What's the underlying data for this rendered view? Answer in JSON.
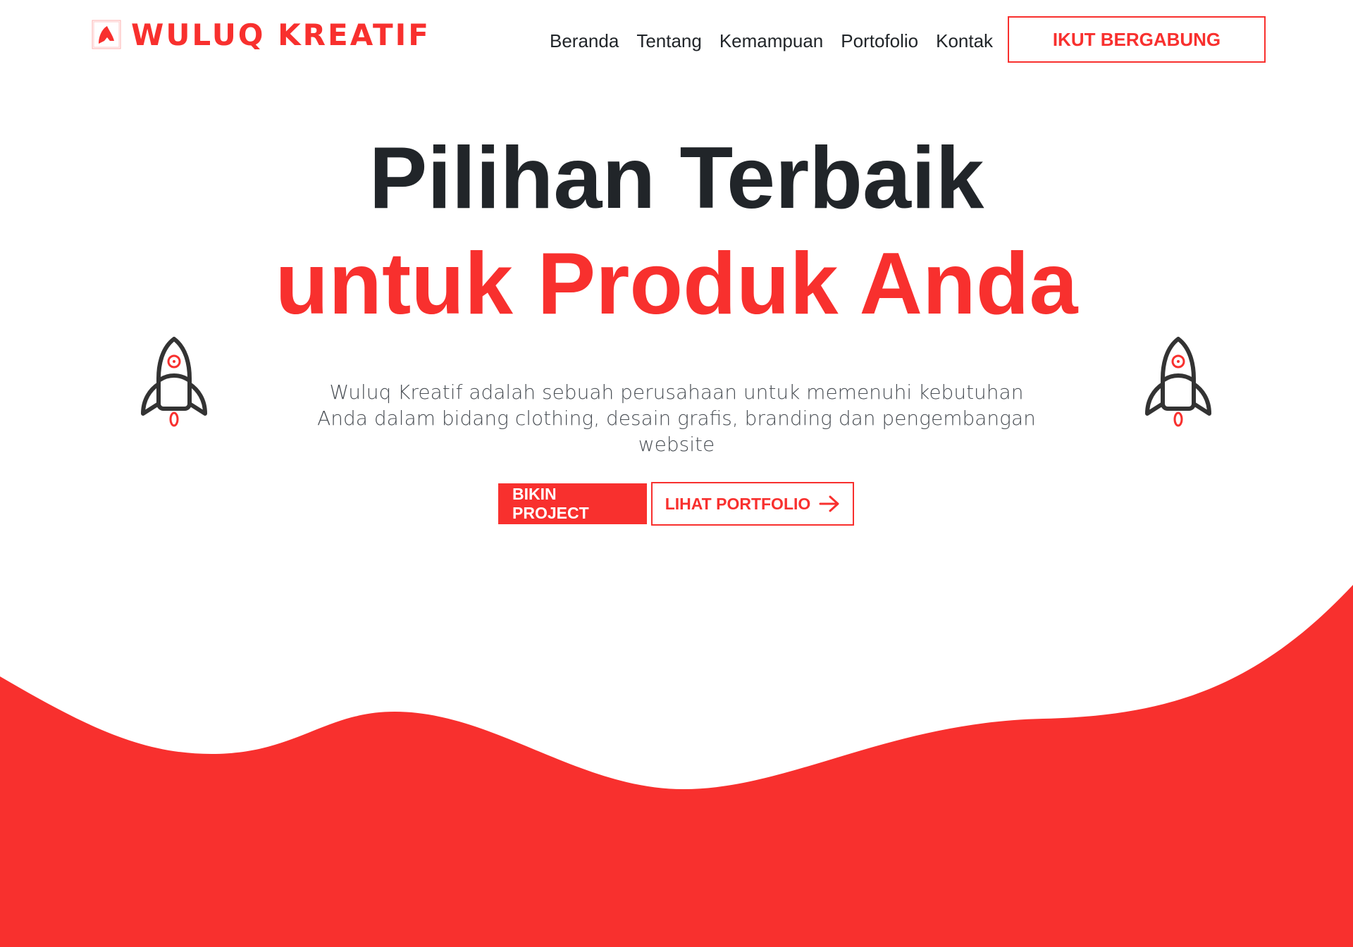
{
  "brand": {
    "name": "WULUQ KREATIF",
    "logo_icon": "brand-logo-icon",
    "color": "#f8302e"
  },
  "nav": {
    "items": [
      {
        "label": "Beranda"
      },
      {
        "label": "Tentang"
      },
      {
        "label": "Kemampuan"
      },
      {
        "label": "Portofolio"
      },
      {
        "label": "Kontak"
      }
    ],
    "cta_label": "IKUT BERGABUNG"
  },
  "hero": {
    "title_line1": "Pilihan Terbaik",
    "title_line2": "untuk Produk Anda",
    "description": "Wuluq Kreatif adalah sebuah perusahaan untuk memenuhi kebutuhan Anda dalam bidang clothing, desain grafis, branding dan pengembangan website",
    "primary_button": "BIKIN PROJECT",
    "secondary_button": "LIHAT PORTFOLIO",
    "secondary_icon": "arrow-right-icon",
    "decor_icon": "rocket-icon"
  },
  "colors": {
    "accent": "#f8302e",
    "text_dark": "#212529",
    "text_muted": "#4a4f55",
    "background": "#ffffff"
  }
}
